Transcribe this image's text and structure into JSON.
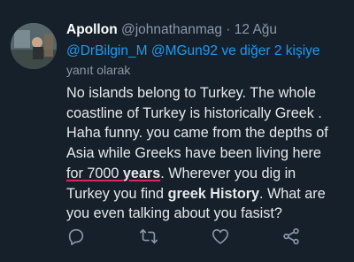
{
  "tweet": {
    "author_name": "Apollon",
    "handle": "@johnathanmag",
    "separator": "·",
    "date": "12 Ağu",
    "reply_to": {
      "mention1": "@DrBilgin_M",
      "mention2": "@MGun92",
      "connector": "ve",
      "others": "diğer 2 kişiye",
      "suffix": "yanıt olarak"
    },
    "body": {
      "line1": "No islands belong to Turkey. The whole",
      "line2": "coastline of Turkey is historically Greek .",
      "line3": "Haha funny. you came from the depths of",
      "line4": "Asia while Greeks have been living here",
      "line5_a": "for 7000 ",
      "line5_b": "years",
      "line5_c": ". Wherever you dig in",
      "line6_a": "Turkey you find ",
      "line6_b": "greek History",
      "line6_c": ". What are",
      "line7": "you even talking about you fasist?"
    }
  },
  "icons": [
    "reply-icon",
    "retweet-icon",
    "like-icon",
    "share-icon"
  ],
  "colors": {
    "background": "#15202b",
    "text": "#e7e9ea",
    "muted": "#8b98a5",
    "link": "#1d9bf0",
    "underline": "#e0245e"
  }
}
